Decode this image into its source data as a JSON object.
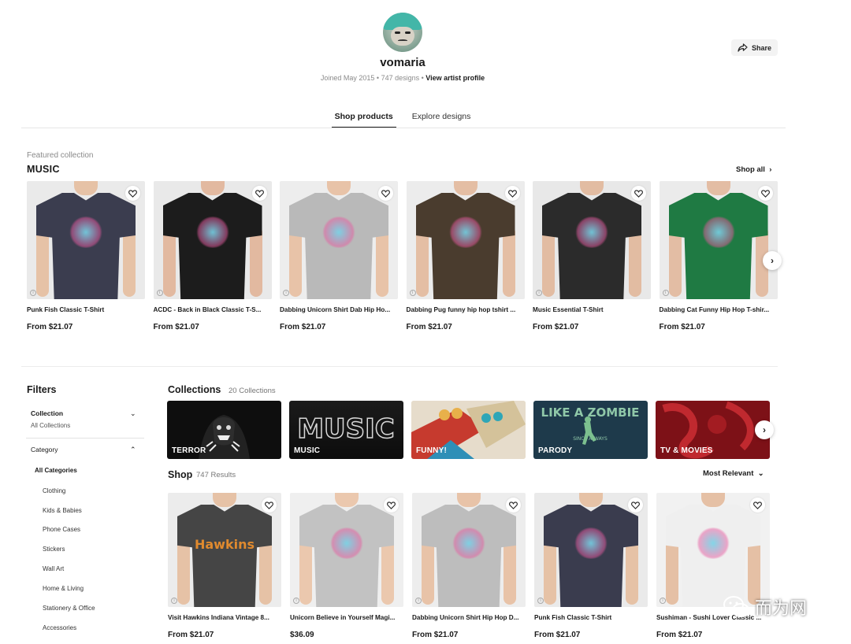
{
  "profile": {
    "name": "vomaria",
    "joined": "Joined May 2015",
    "designs": "747 designs",
    "view_link": "View artist profile",
    "share_label": "Share"
  },
  "tabs": [
    {
      "label": "Shop products",
      "active": true
    },
    {
      "label": "Explore designs",
      "active": false
    }
  ],
  "featured": {
    "label": "Featured collection",
    "title": "MUSIC",
    "shop_all": "Shop all",
    "products": [
      {
        "title": "Punk Fish Classic T-Shirt",
        "price": "From $21.07",
        "shirt_color": "#3b3d4f",
        "skin": "#e6c2a6",
        "bg": "#eaeaea"
      },
      {
        "title": "ACDC - Back in Black Classic T-S...",
        "price": "From $21.07",
        "shirt_color": "#1c1c1c",
        "skin": "#e2b9a0",
        "bg": "#e9e9e9"
      },
      {
        "title": "Dabbing Unicorn Shirt Dab Hip Ho...",
        "price": "From $21.07",
        "shirt_color": "#b9b9b9",
        "skin": "#e8c3a8",
        "bg": "#ededed"
      },
      {
        "title": "Dabbing Pug funny hip hop tshirt ...",
        "price": "From $21.07",
        "shirt_color": "#4a3c2e",
        "skin": "#e4bea4",
        "bg": "#ececec"
      },
      {
        "title": "Music Essential T-Shirt",
        "price": "From $21.07",
        "shirt_color": "#2b2b2b",
        "skin": "#e2bca2",
        "bg": "#e8e8e8"
      },
      {
        "title": "Dabbing Cat Funny Hip Hop T-shir...",
        "price": "From $21.07",
        "shirt_color": "#1f7a43",
        "skin": "#e3bda4",
        "bg": "#ebebeb"
      }
    ]
  },
  "filters": {
    "title": "Filters",
    "collection_label": "Collection",
    "collection_value": "All Collections",
    "category_label": "Category",
    "categories": [
      "All Categories",
      "Clothing",
      "Kids & Babies",
      "Phone Cases",
      "Stickers",
      "Wall Art",
      "Home & Living",
      "Stationery & Office",
      "Accessories"
    ]
  },
  "collections": {
    "title": "Collections",
    "count": "20 Collections",
    "items": [
      {
        "label": "TERROR",
        "bg": "#111111"
      },
      {
        "label": "MUSIC",
        "bg": "#161616"
      },
      {
        "label": "FUNNY!",
        "bg": "#e9e3d8"
      },
      {
        "label": "PARODY",
        "bg": "#1f3a4a"
      },
      {
        "label": "TV & MOVIES",
        "bg": "#7a0f14"
      }
    ],
    "art_text": {
      "music": "MUSIC",
      "parody_top": "LIKE A ZOMBIE",
      "parody_bottom": "SINCE ALWAYS"
    }
  },
  "shop": {
    "title": "Shop",
    "count": "747 Results",
    "sort": "Most Relevant",
    "products": [
      {
        "title": "Visit Hawkins Indiana Vintage 8...",
        "price": "From $21.07",
        "shirt_color": "#454545",
        "skin": "#e6c2a6",
        "bg": "#ececec",
        "print": "Hawkins"
      },
      {
        "title": "Unicorn Believe in Yourself Magi...",
        "price": "$36.09",
        "shirt_color": "#c2c2c2",
        "skin": "#ebc8ae",
        "bg": "#efefef",
        "print": ""
      },
      {
        "title": "Dabbing Unicorn Shirt Hip Hop D...",
        "price": "From $21.07",
        "shirt_color": "#bdbdbd",
        "skin": "#e8c3a8",
        "bg": "#ededed",
        "print": ""
      },
      {
        "title": "Punk Fish Classic T-Shirt",
        "price": "From $21.07",
        "shirt_color": "#3a3c4e",
        "skin": "#e6c2a6",
        "bg": "#eaeaea",
        "print": ""
      },
      {
        "title": "Sushiman - Sushi Lover Classic ...",
        "price": "From $21.07",
        "shirt_color": "#efefef",
        "skin": "#e5c0a5",
        "bg": "#f1f1f1",
        "print": ""
      }
    ]
  },
  "watermark": "而为网",
  "icons": {
    "heart": "heart-icon",
    "share": "share-icon",
    "chevron_right": "chevron-right-icon",
    "chevron_down": "chevron-down-icon",
    "chevron_up": "chevron-up-icon",
    "info": "info-icon"
  }
}
